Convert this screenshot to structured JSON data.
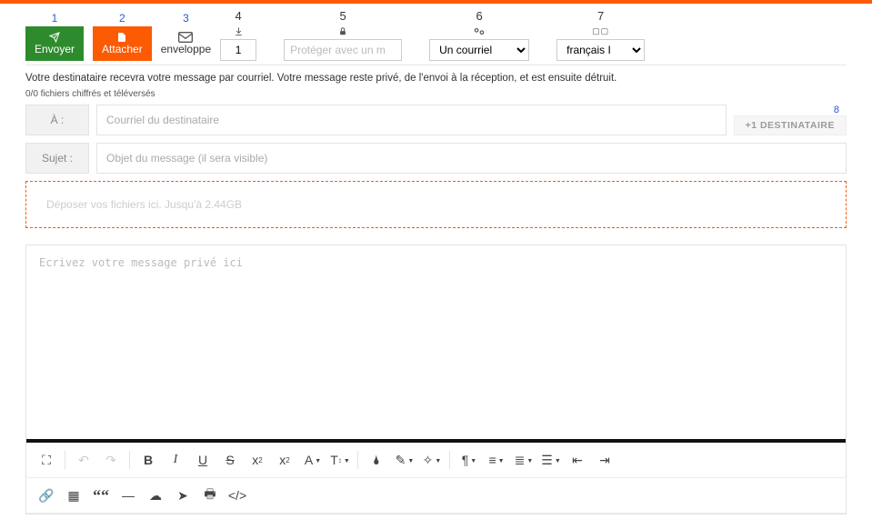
{
  "toolbar": {
    "nums": [
      "1",
      "2",
      "3",
      "4",
      "5",
      "6",
      "7"
    ],
    "send_label": "Envoyer",
    "attach_label": "Attacher",
    "envelope_label": "enveloppe",
    "copies_value": "1",
    "password_placeholder": "Protéger avec un m",
    "type_option": "Un courriel",
    "lang_option": "français I"
  },
  "desc_text": "Votre destinataire recevra votre message par courriel. Votre message reste privé, de l'envoi à la réception, et est ensuite détruit.",
  "fileinfo_text": "0/0 fichiers chiffrés et téléversés",
  "to": {
    "label": "À :",
    "placeholder": "Courriel du destinataire"
  },
  "add_dest": {
    "num": "8",
    "label": "+1 DESTINATAIRE"
  },
  "subject": {
    "label": "Sujet :",
    "placeholder": "Objet du message (il sera visible)"
  },
  "dropzone_text": "Déposer vos fichiers ici. Jusqu'à 2.44GB",
  "editor_placeholder": "Ecrivez votre message privé ici"
}
